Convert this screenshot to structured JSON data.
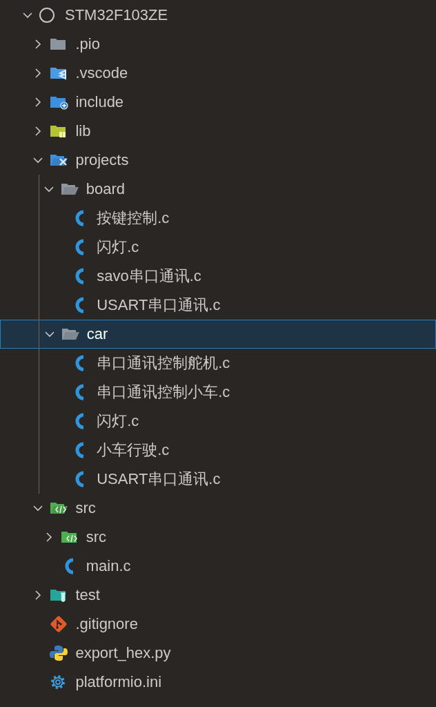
{
  "explorer": {
    "tree": [
      {
        "label": "STM32F103ZE",
        "kind": "root",
        "expanded": true,
        "selected": false,
        "children": [
          {
            "label": ".pio",
            "kind": "pio",
            "expanded": false,
            "selected": false
          },
          {
            "label": ".vscode",
            "kind": "vscode",
            "expanded": false,
            "selected": false
          },
          {
            "label": "include",
            "kind": "include",
            "expanded": false,
            "selected": false
          },
          {
            "label": "lib",
            "kind": "lib",
            "expanded": false,
            "selected": false
          },
          {
            "label": "projects",
            "kind": "projects",
            "expanded": true,
            "selected": false,
            "children": [
              {
                "label": "board",
                "kind": "folder",
                "expanded": true,
                "selected": false,
                "children": [
                  {
                    "label": "按键控制.c",
                    "kind": "c",
                    "selected": false
                  },
                  {
                    "label": "闪灯.c",
                    "kind": "c",
                    "selected": false
                  },
                  {
                    "label": "savo串口通讯.c",
                    "kind": "c",
                    "selected": false
                  },
                  {
                    "label": "USART串口通讯.c",
                    "kind": "c",
                    "selected": false
                  }
                ]
              },
              {
                "label": "car",
                "kind": "folder",
                "expanded": true,
                "selected": true,
                "children": [
                  {
                    "label": "串口通讯控制舵机.c",
                    "kind": "c",
                    "selected": false
                  },
                  {
                    "label": "串口通讯控制小车.c",
                    "kind": "c",
                    "selected": false
                  },
                  {
                    "label": "闪灯.c",
                    "kind": "c",
                    "selected": false
                  },
                  {
                    "label": "小车行驶.c",
                    "kind": "c",
                    "selected": false
                  },
                  {
                    "label": "USART串口通讯.c",
                    "kind": "c",
                    "selected": false
                  }
                ]
              }
            ]
          },
          {
            "label": "src",
            "kind": "src",
            "expanded": true,
            "selected": false,
            "children": [
              {
                "label": "src",
                "kind": "src",
                "expanded": false,
                "selected": false
              },
              {
                "label": "main.c",
                "kind": "c",
                "selected": false
              }
            ]
          },
          {
            "label": "test",
            "kind": "test",
            "expanded": false,
            "selected": false
          },
          {
            "label": ".gitignore",
            "kind": "git",
            "selected": false
          },
          {
            "label": "export_hex.py",
            "kind": "python",
            "selected": false
          },
          {
            "label": "platformio.ini",
            "kind": "settings",
            "selected": false
          }
        ]
      }
    ]
  }
}
